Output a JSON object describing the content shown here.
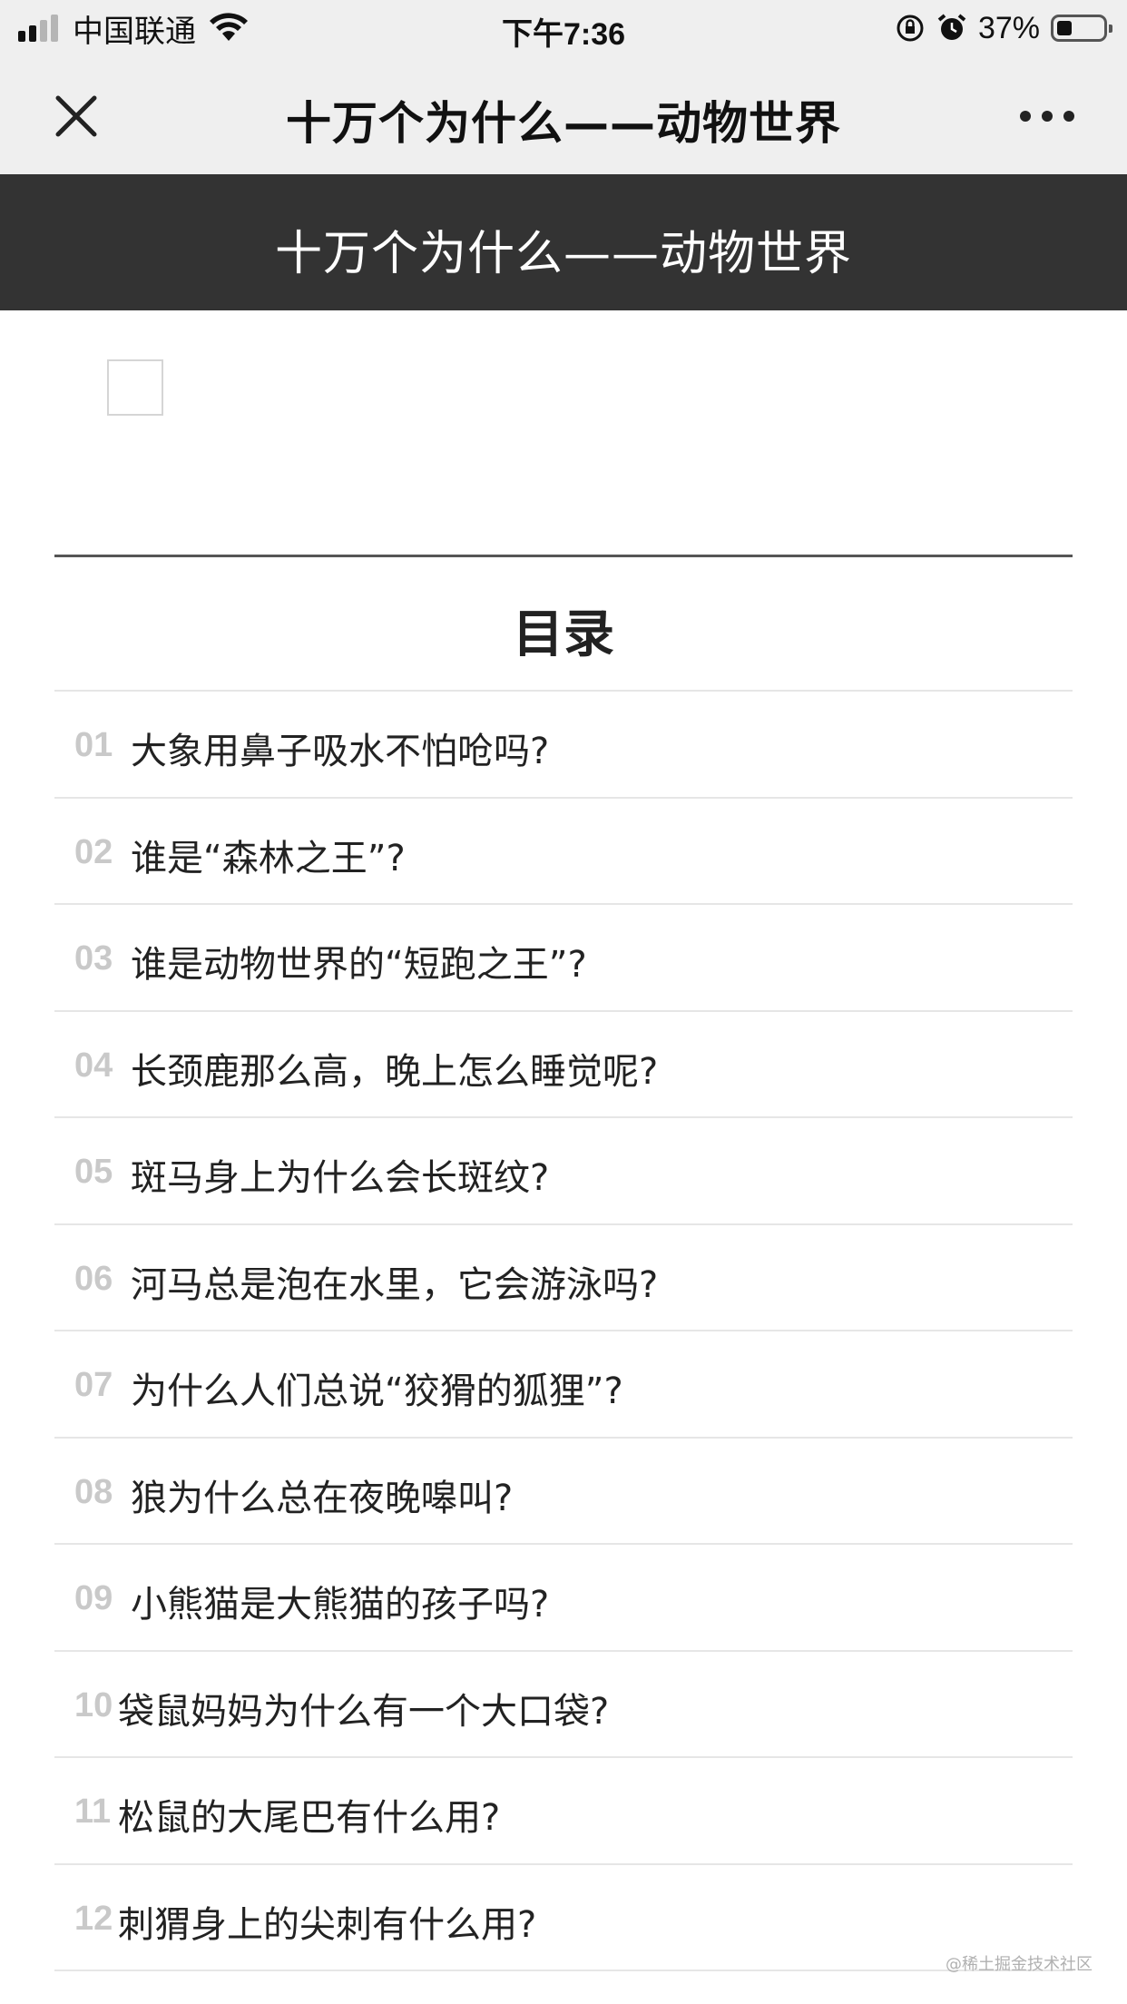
{
  "status_bar": {
    "carrier": "中国联通",
    "time": "下午7:36",
    "battery_percent": "37%",
    "signal_bars": 4,
    "signal_bars_filled": 2,
    "icons": [
      "signal-icon",
      "wifi-icon",
      "orientation-lock-icon",
      "alarm-icon",
      "battery-icon"
    ]
  },
  "nav": {
    "title": "十万个为什么——动物世界",
    "close_icon": "close-icon",
    "more_icon": "more-dots-icon"
  },
  "banner": {
    "title": "十万个为什么——动物世界"
  },
  "toc": {
    "title": "目录",
    "items": [
      {
        "num": "01",
        "text": "大象用鼻子吸水不怕呛吗?"
      },
      {
        "num": "02",
        "text": "谁是“森林之王”?"
      },
      {
        "num": "03",
        "text": "谁是动物世界的“短跑之王”?"
      },
      {
        "num": "04",
        "text": "长颈鹿那么高，晚上怎么睡觉呢?"
      },
      {
        "num": "05",
        "text": "斑马身上为什么会长斑纹?"
      },
      {
        "num": "06",
        "text": "河马总是泡在水里，它会游泳吗?"
      },
      {
        "num": "07",
        "text": "为什么人们总说“狡猾的狐狸”?"
      },
      {
        "num": "08",
        "text": "狼为什么总在夜晚嗥叫?"
      },
      {
        "num": "09",
        "text": "小熊猫是大熊猫的孩子吗?"
      },
      {
        "num": "10",
        "text": "袋鼠妈妈为什么有一个大口袋?"
      },
      {
        "num": "11",
        "text": "松鼠的大尾巴有什么用?"
      },
      {
        "num": "12",
        "text": "刺猬身上的尖刺有什么用?"
      }
    ]
  },
  "watermark": "@稀土掘金技术社区"
}
